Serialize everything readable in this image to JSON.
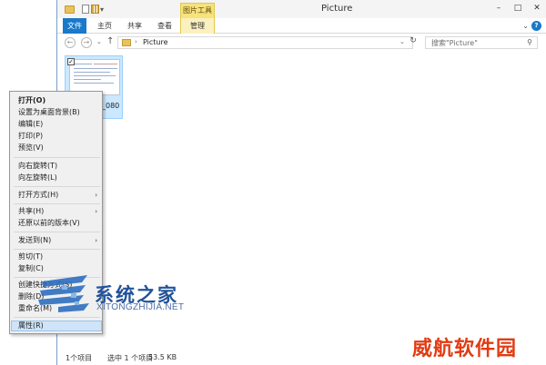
{
  "window": {
    "title": "Picture",
    "contextual_tab": "图片工具",
    "controls": {
      "minimize": "–",
      "maximize": "□",
      "close": "✕"
    }
  },
  "ribbon": {
    "tabs": [
      "文件",
      "主页",
      "共享",
      "查看",
      "管理"
    ],
    "collapse": "⌄",
    "help": "?"
  },
  "address_bar": {
    "back": "←",
    "forward": "→",
    "recent": "⌄",
    "up": "↑",
    "breadcrumb_arrow": "›",
    "path": "Picture",
    "dropdown": "⌄",
    "refresh": "↻",
    "search_placeholder": "搜索\"Picture\"",
    "search_icon": "⚲"
  },
  "file": {
    "name": "_080",
    "checked": "✓"
  },
  "status_bar": {
    "item_count": "1个项目",
    "selected": "选中 1 个项目",
    "size": "53.5 KB"
  },
  "context_menu": {
    "items": [
      {
        "label": "打开(O)",
        "bold": true
      },
      {
        "label": "设置为桌面背景(B)"
      },
      {
        "label": "编辑(E)"
      },
      {
        "label": "打印(P)"
      },
      {
        "label": "预览(V)"
      },
      {
        "label": "向右旋转(T)"
      },
      {
        "label": "向左旋转(L)"
      },
      {
        "label": "打开方式(H)",
        "submenu": "›"
      },
      {
        "label": "共享(H)",
        "submenu": "›"
      },
      {
        "label": "还原以前的版本(V)"
      },
      {
        "label": "发送到(N)",
        "submenu": "›"
      },
      {
        "label": "剪切(T)"
      },
      {
        "label": "复制(C)"
      },
      {
        "label": "创建快捷方式(S)"
      },
      {
        "label": "删除(D)"
      },
      {
        "label": "重命名(M)"
      },
      {
        "label": "属性(R)",
        "hovered": true
      }
    ]
  },
  "watermarks": {
    "site_name": "系统之家",
    "site_url": "XITONGZHIJIA.NET",
    "brand": "威航软件园"
  },
  "colors": {
    "accent": "#1979ca",
    "selection": "#cce8ff",
    "contextual_tab": "#f7e27c",
    "watermark_blue": "#22539a",
    "watermark_red": "#e23b12"
  }
}
